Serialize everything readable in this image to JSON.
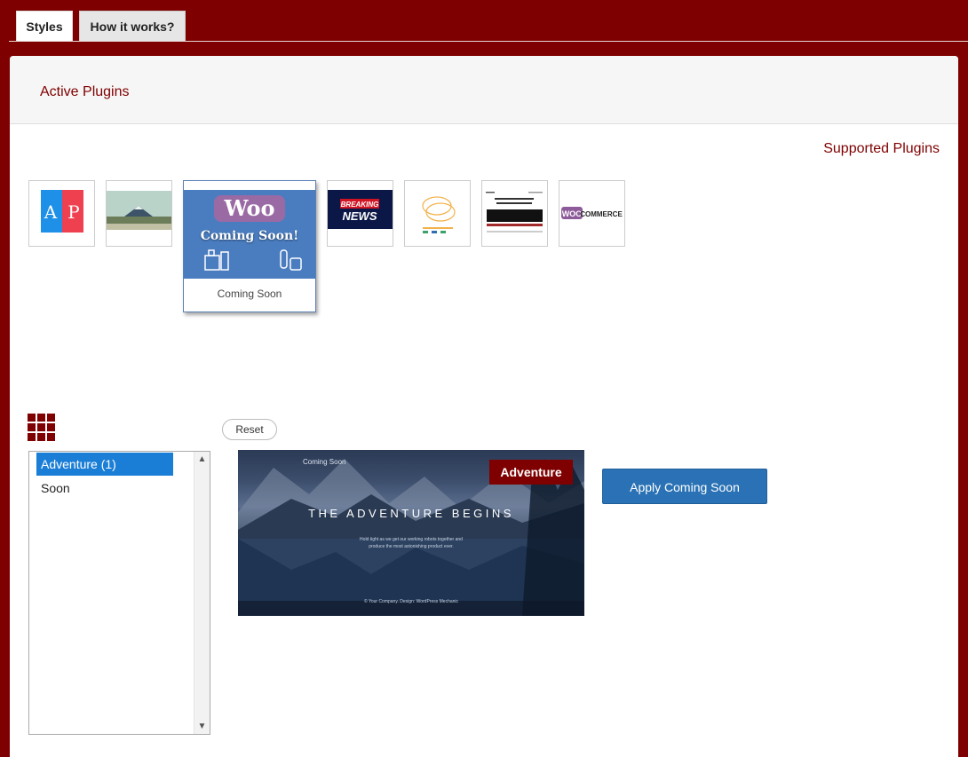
{
  "tabs": [
    {
      "label": "Styles",
      "active": true
    },
    {
      "label": "How it works?",
      "active": false
    }
  ],
  "panel": {
    "title": "Active Plugins",
    "supported_label": "Supported Plugins"
  },
  "plugins": {
    "thumbs": [
      {
        "name": "ap-plugin",
        "text": "A P"
      },
      {
        "name": "landscape-plugin"
      },
      {
        "name": "breaking-news-plugin",
        "line1": "BREAKING",
        "line2": "NEWS"
      },
      {
        "name": "css-card-plugin"
      },
      {
        "name": "museum-plugin"
      },
      {
        "name": "woocommerce-plugin",
        "woo": "WOO",
        "commerce": "COMMERCE"
      }
    ],
    "featured": {
      "woo": "Woo",
      "headline": "Coming Soon!",
      "label": "Coming Soon"
    }
  },
  "controls": {
    "reset_label": "Reset",
    "apply_label": "Apply Coming Soon"
  },
  "style_list": {
    "options": [
      {
        "label": "Adventure (1)",
        "selected": true
      },
      {
        "label": "Soon",
        "selected": false
      }
    ]
  },
  "preview": {
    "badge": "Adventure",
    "corner_text": "Coming Soon",
    "title": "THE ADVENTURE BEGINS",
    "subtitle": "Hold tight as we get our working robots together and produce the most astonishing product ever.",
    "footer": "© Your Company. Design: WordPress Mechanic"
  },
  "colors": {
    "brand": "#7f0000",
    "selection": "#1b7ed6",
    "apply_button": "#2a72b5",
    "featured_bg": "#4a7dc0"
  }
}
